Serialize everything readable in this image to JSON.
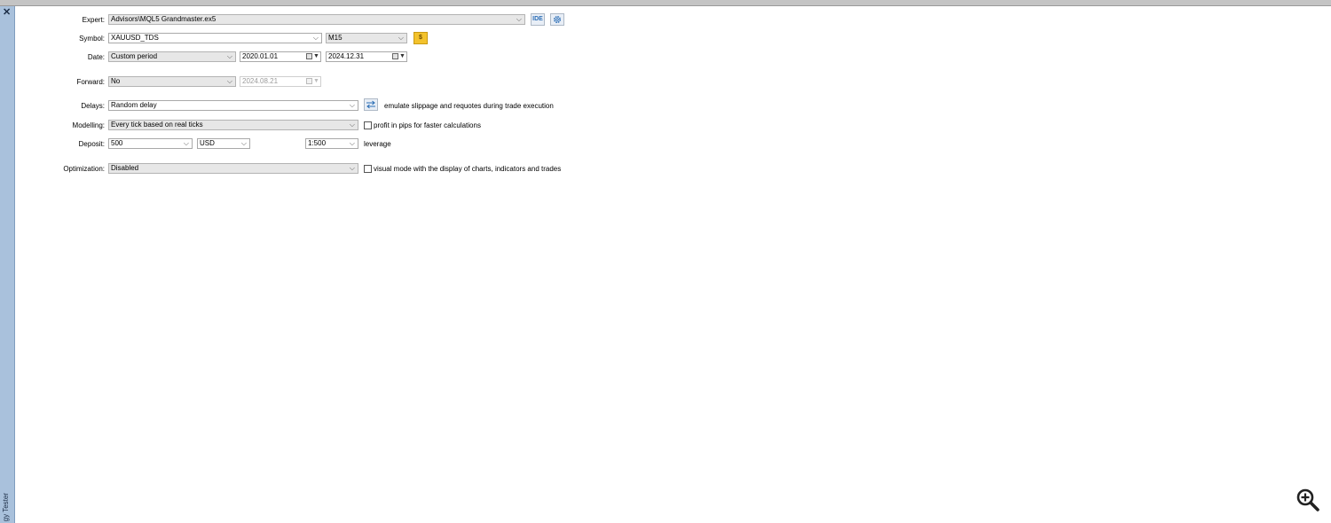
{
  "sidebar": {
    "close_glyph": "✕",
    "title": "gy Tester"
  },
  "expert": {
    "label": "Expert:",
    "value": "Advisors\\MQL5 Grandmaster.ex5",
    "ide_label": "IDE",
    "settings_icon": "gear-icon"
  },
  "symbol": {
    "label": "Symbol:",
    "value": "XAUUSD_TDS",
    "timeframe": "M15",
    "spec_icon": "dollar-icon",
    "spec_glyph": "$"
  },
  "date": {
    "label": "Date:",
    "mode": "Custom period",
    "from": "2020.01.01",
    "to": "2024.12.31"
  },
  "forward": {
    "label": "Forward:",
    "mode": "No",
    "date": "2024.08.21"
  },
  "delays": {
    "label": "Delays:",
    "value": "Random delay",
    "note": "emulate slippage and requotes during trade execution"
  },
  "modelling": {
    "label": "Modelling:",
    "value": "Every tick based on real ticks",
    "checkbox_label": "profit in pips for faster calculations"
  },
  "deposit": {
    "label": "Deposit:",
    "amount": "500",
    "currency": "USD",
    "leverage": "1:500",
    "leverage_label": "leverage"
  },
  "optimization": {
    "label": "Optimization:",
    "value": "Disabled",
    "checkbox_label": "visual mode with the display of charts, indicators and trades"
  },
  "colors": {
    "sidebar": "#a9c1dc",
    "accent": "#2a6db5",
    "gold": "#f3c22c"
  }
}
